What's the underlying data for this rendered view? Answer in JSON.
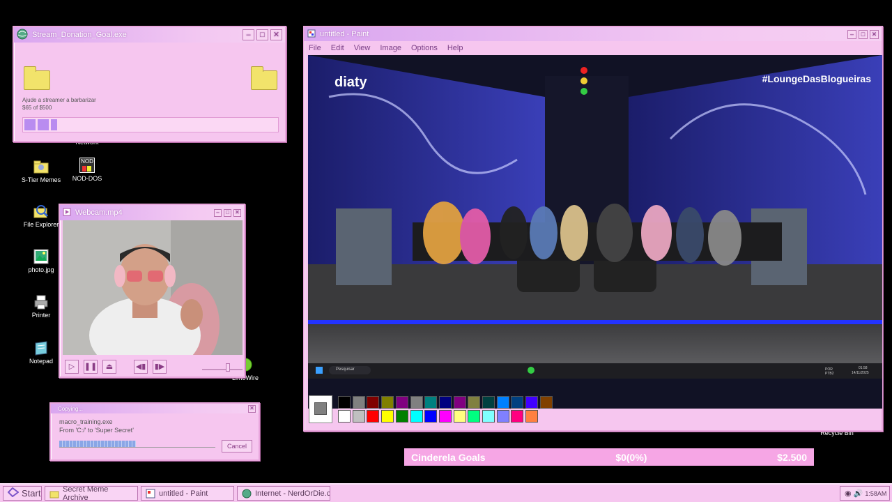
{
  "donation_window": {
    "title": "Stream_Donation_Goal.exe",
    "text": "Ajude a streamer a barbarizar",
    "amount": "$65 of $500",
    "progress_fraction": 0.13
  },
  "desktop_icons": [
    {
      "label": "Network"
    },
    {
      "label": "S-Tier Memes"
    },
    {
      "label": "NOD-DOS",
      "icon_text": "NOD"
    },
    {
      "label": "File Explorer"
    },
    {
      "label": "photo.jpg"
    },
    {
      "label": "Printer"
    },
    {
      "label": "Notepad"
    },
    {
      "label": "LimeWire"
    },
    {
      "label": "Recycle Bin"
    }
  ],
  "webcam_window": {
    "title": "Webcam.mp4"
  },
  "copying_dialog": {
    "title": "Copying...",
    "filename": "macro_training.exe",
    "from_to": "From 'C:/' to 'Super Secret'",
    "cancel_label": "Cancel",
    "progress_fraction": 0.49
  },
  "paint_window": {
    "title": "untitled - Paint",
    "menu": [
      "File",
      "Edit",
      "View",
      "Image",
      "Options",
      "Help"
    ],
    "stream": {
      "brand": "diaty",
      "hashtag": "#LoungeDasBlogueiras",
      "search_placeholder": "Pesquisar",
      "tray_lang": "POR PTB2",
      "tray_time": "01:58",
      "tray_date": "14/11/2025"
    },
    "palette_top": [
      "#000000",
      "#808080",
      "#800000",
      "#808000",
      "#800080",
      "#808080",
      "#008080",
      "#000080",
      "#800080",
      "#808040",
      "#004040",
      "#0080ff",
      "#004080",
      "#4000ff",
      "#804000"
    ],
    "palette_bottom": [
      "#ffffff",
      "#c0c0c0",
      "#ff0000",
      "#ffff00",
      "#008000",
      "#00ffff",
      "#0000ff",
      "#ff00ff",
      "#ffff80",
      "#00ff80",
      "#80ffff",
      "#8080ff",
      "#ff0080",
      "#ff8040"
    ]
  },
  "cinderella_bar": {
    "label": "Cinderela Goals",
    "amount": "$0(0%)",
    "goal": "$2.500"
  },
  "taskbar": {
    "start_label": "Start",
    "items": [
      "Secret Meme Archive",
      "untitled - Paint",
      "Internet - NerdOrDie.com"
    ],
    "clock": "1:58AM"
  },
  "colors": {
    "window_pink": "#f6c6ef",
    "accent_purple": "#b98cf0",
    "bar_pink": "#f6a6e5"
  }
}
